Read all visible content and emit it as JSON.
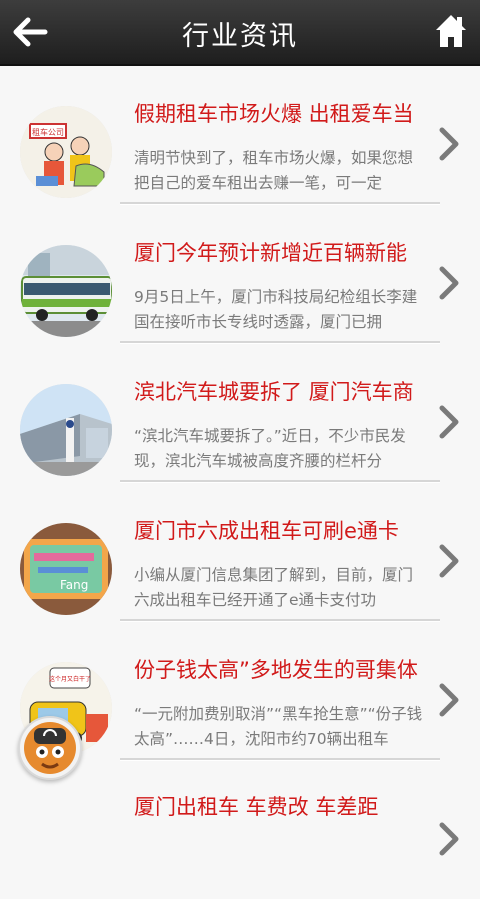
{
  "header": {
    "title": "行业资讯",
    "back_icon": "back-arrow-icon",
    "home_icon": "home-icon"
  },
  "news": [
    {
      "title": "假期租车市场火爆 出租爱车当",
      "desc": "清明节快到了，租车市场火爆，如果您想把自己的爱车租出去赚一笔，可一定",
      "thumb_caption": "租车公司"
    },
    {
      "title": "厦门今年预计新增近百辆新能",
      "desc": "9月5日上午，厦门市科技局纪检组长李建国在接听市长专线时透露，厦门已拥"
    },
    {
      "title": "滨北汽车城要拆了 厦门汽车商",
      "desc": "“滨北汽车城要拆了。”近日，不少市民发现，滨北汽车城被高度齐腰的栏杆分"
    },
    {
      "title": "厦门市六成出租车可刷e通卡",
      "desc": "小编从厦门信息集团了解到，目前，厦门六成出租车已经开通了e通卡支付功",
      "thumb_caption": "Fang"
    },
    {
      "title": "份子钱太高”多地发生的哥集体",
      "desc": "“一元附加费别取消”“黑车抢生意”“份子钱太高”……4日，沈阳市约70辆出租车",
      "thumb_caption": "这个月又白干了"
    },
    {
      "title": "厦门出租车 车费改 车差距",
      "desc": ""
    }
  ],
  "colors": {
    "title_red": "#d11a1a",
    "desc_gray": "#7a7a7a",
    "header_dark": "#2b2b2b"
  }
}
